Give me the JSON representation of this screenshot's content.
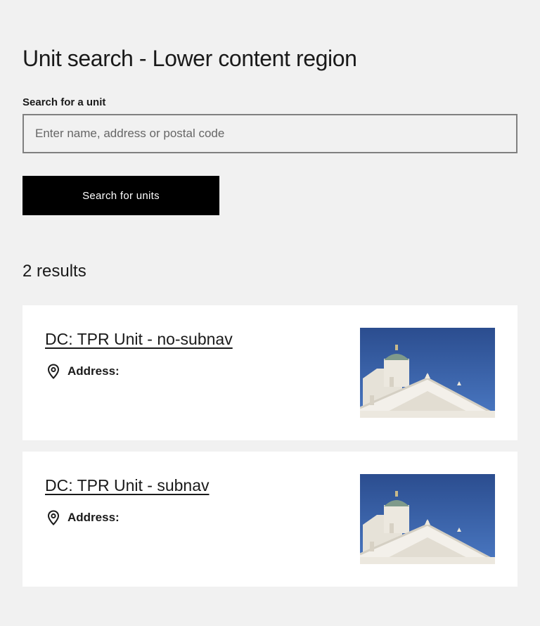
{
  "page": {
    "title": "Unit search - Lower content region"
  },
  "search": {
    "label": "Search for a unit",
    "placeholder": "Enter name, address or postal code",
    "value": "",
    "button_label": "Search for units"
  },
  "results": {
    "count_text": "2 results",
    "items": [
      {
        "title": "DC: TPR Unit - no-subnav",
        "address_label": "Address:",
        "image_icon": "cathedral-photo"
      },
      {
        "title": "DC: TPR Unit - subnav",
        "address_label": "Address:",
        "image_icon": "cathedral-photo"
      }
    ]
  },
  "colors": {
    "background": "#f1f1f1",
    "card": "#ffffff",
    "button": "#000000",
    "sky": "#2f5597"
  }
}
